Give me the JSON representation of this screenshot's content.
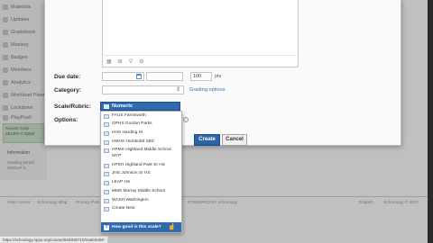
{
  "sidebar": {
    "items": [
      {
        "label": "Materials",
        "icon": "folder-icon"
      },
      {
        "label": "Updates",
        "icon": "updates-icon"
      },
      {
        "label": "Gradebook",
        "icon": "gradebook-icon"
      },
      {
        "label": "Mastery",
        "icon": "mastery-icon"
      },
      {
        "label": "Badges",
        "icon": "badge-icon"
      },
      {
        "label": "Members",
        "icon": "members-icon"
      },
      {
        "label": "Analytics",
        "icon": "analytics-icon"
      },
      {
        "label": "Workload Planning",
        "icon": "workload-icon"
      },
      {
        "label": "Lockdown",
        "icon": "lock-icon"
      },
      {
        "label": "PlayPosit",
        "icon": "app-icon"
      }
    ],
    "access_code": {
      "title": "Access Code",
      "code": "2BCRS-YJQBW"
    },
    "information": {
      "title": "Information",
      "text": "Grading period\nGROUP 3"
    }
  },
  "modal": {
    "due_date": {
      "label": "Due date:",
      "points": "100",
      "points_unit": "pts"
    },
    "category": {
      "label": "Category:",
      "grading_link": "Grading options"
    },
    "scale": {
      "label": "Scale/Rubric:",
      "selected": "Numeric"
    },
    "options": {
      "label": "Options:"
    },
    "create_label": "Create",
    "cancel_label": "Cancel"
  },
  "dropdown": {
    "items": [
      "FAUS Farnsworth",
      "GPHS Gordon Parks",
      "HHS Harding Sr",
      "HMHS Humboldt SBC",
      "HPMS Highland Middle School MYP",
      "HPSH Highland Park Sr HS",
      "JHS Johnson Sr HS",
      "LEAP HS",
      "MMS Murray Middle School",
      "WASH Washington"
    ],
    "create_new": "Create New",
    "help": "How good is this scale?"
  },
  "footer": {
    "links": [
      "Help Center",
      "Schoology Blog",
      "Privacy Policy"
    ],
    "powered_by": "POWERED BY schoology",
    "language": "English",
    "copyright": "Schoology © 2017"
  },
  "status_url": "https://schoology.spps.org/course/944835710/materials#"
}
